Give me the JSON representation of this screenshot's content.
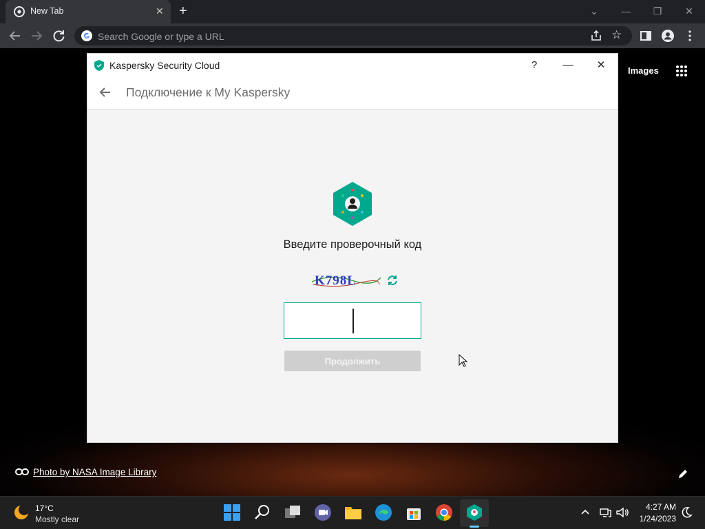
{
  "browser": {
    "tab_title": "New Tab",
    "tab_close": "✕",
    "new_tab": "+",
    "omnibox_placeholder": "Search Google or type a URL",
    "window_controls": {
      "minimize": "—",
      "restore": "❐",
      "close": "✕",
      "tab_search": "⌄"
    }
  },
  "newtab_page": {
    "images_link": "Images",
    "photo_credit": "Photo by NASA Image Library"
  },
  "kaspersky": {
    "window_title": "Kaspersky Security Cloud",
    "help": "?",
    "minimize": "—",
    "close": "✕",
    "heading": "Подключение к My Kaspersky",
    "prompt": "Введите проверочный код",
    "captcha_text": "K798L",
    "code_input_value": "",
    "continue_label": "Продолжить",
    "accent_color": "#00a88e"
  },
  "taskbar": {
    "weather_temp": "17°C",
    "weather_desc": "Mostly clear",
    "time": "4:27 AM",
    "date": "1/24/2023",
    "apps": [
      "start-icon",
      "search-icon",
      "task-view-icon",
      "chat-icon",
      "file-explorer-icon",
      "edge-icon",
      "store-icon",
      "chrome-icon",
      "kaspersky-icon"
    ]
  }
}
